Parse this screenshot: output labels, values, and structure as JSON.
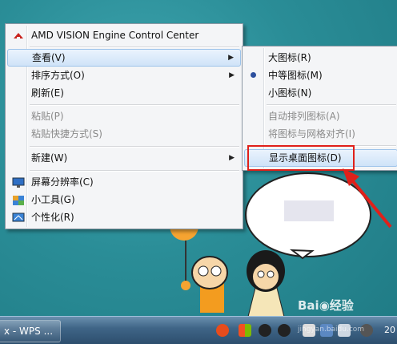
{
  "context_menu": {
    "items": [
      {
        "label": "AMD VISION Engine Control Center",
        "icon": "amd-icon",
        "enabled": true
      },
      {
        "label": "查看(V)",
        "submenu": true,
        "enabled": true,
        "highlighted": true
      },
      {
        "label": "排序方式(O)",
        "submenu": true,
        "enabled": true
      },
      {
        "label": "刷新(E)",
        "enabled": true
      },
      {
        "label": "粘贴(P)",
        "enabled": false
      },
      {
        "label": "粘贴快捷方式(S)",
        "enabled": false
      },
      {
        "label": "新建(W)",
        "submenu": true,
        "enabled": true
      },
      {
        "label": "屏幕分辨率(C)",
        "icon": "display-icon",
        "enabled": true
      },
      {
        "label": "小工具(G)",
        "icon": "gadgets-icon",
        "enabled": true
      },
      {
        "label": "个性化(R)",
        "icon": "personalize-icon",
        "enabled": true
      }
    ]
  },
  "view_submenu": {
    "items": [
      {
        "label": "大图标(R)",
        "enabled": true
      },
      {
        "label": "中等图标(M)",
        "enabled": true,
        "selected": true
      },
      {
        "label": "小图标(N)",
        "enabled": true
      },
      {
        "label": "自动排列图标(A)",
        "enabled": false
      },
      {
        "label": "将图标与网格对齐(I)",
        "enabled": false
      },
      {
        "label": "显示桌面图标(D)",
        "enabled": true,
        "highlighted": true
      }
    ]
  },
  "taskbar": {
    "item_label": "x - WPS ...",
    "tray_icons": [
      "sogou-icon",
      "windows-flag-icon",
      "qq-icon",
      "qq-icon",
      "clipboard-icon",
      "network-icon",
      "volume-icon",
      "wps-icon"
    ],
    "clock": "20"
  },
  "watermark": {
    "brand": "Bai",
    "brand2": "经验",
    "url": "jingyan.baidu.com"
  },
  "colors": {
    "highlight_border": "#e0201a",
    "arrow": "#e0201a",
    "desktop": "#2a8d97"
  }
}
